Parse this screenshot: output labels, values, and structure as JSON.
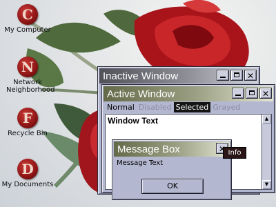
{
  "desktop_icons": [
    {
      "label": "My Computer",
      "glyph": "C",
      "icon": "my-computer-icon"
    },
    {
      "label": "Network Neighborhood",
      "glyph": "N",
      "icon": "network-neighborhood-icon"
    },
    {
      "label": "Recycle Bin",
      "glyph": "F",
      "icon": "recycle-bin-icon"
    },
    {
      "label": "My Documents",
      "glyph": "D",
      "icon": "my-documents-icon"
    }
  ],
  "inactive_window": {
    "title": "Inactive Window"
  },
  "active_window": {
    "title": "Active Window",
    "menu": {
      "normal": "Normal",
      "disabled": "Disabled",
      "selected": "Selected",
      "grayed": "Grayed"
    },
    "window_text": "Window Text"
  },
  "message_box": {
    "title": "Message Box",
    "text": "Message Text",
    "ok_label": "OK"
  },
  "tooltip": {
    "text": "Info"
  },
  "title_buttons": {
    "minimize": "minimize-icon",
    "maximize": "maximize-icon",
    "close": "✕"
  },
  "scroll_arrows": {
    "up": "▲",
    "down": "▼"
  },
  "colors": {
    "window_face": "#b4b7d0",
    "active_title_start": "#646a48",
    "inactive_title_start": "#505058",
    "selected_menu": "#141414",
    "wallpaper_rose": "#b01418"
  }
}
